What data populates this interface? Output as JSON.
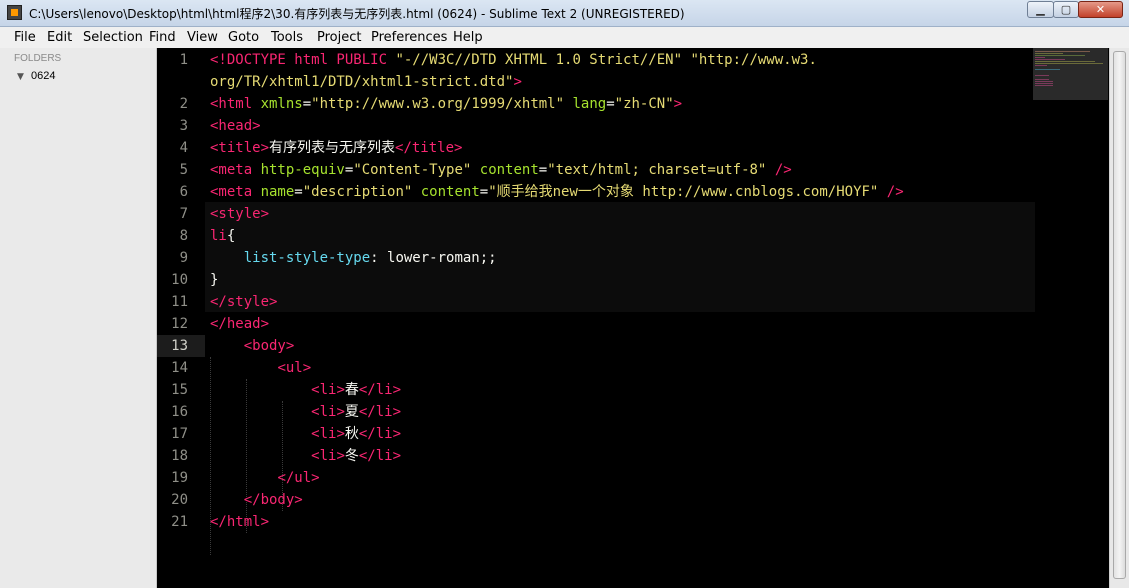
{
  "window": {
    "title": "C:\\Users\\lenovo\\Desktop\\html\\html程序2\\30.有序列表与无序列表.html (0624) - Sublime Text 2 (UNREGISTERED)",
    "minimize_glyph": "▁",
    "maximize_glyph": "▢",
    "close_glyph": "✕"
  },
  "menu": {
    "items": [
      "File",
      "Edit",
      "Selection",
      "Find",
      "View",
      "Goto",
      "Tools",
      "Project",
      "Preferences",
      "Help"
    ]
  },
  "sidebar": {
    "header": "FOLDERS",
    "arrow": "▼",
    "folder": "0624"
  },
  "editor": {
    "line_numbers": [
      "1",
      "2",
      "3",
      "4",
      "5",
      "6",
      "7",
      "8",
      "9",
      "10",
      "11",
      "12",
      "13",
      "14",
      "15",
      "16",
      "17",
      "18",
      "19",
      "20",
      "21"
    ],
    "current_line": "13",
    "lines": [
      [
        {
          "c": "tag",
          "t": "<!DOCTYPE html PUBLIC "
        },
        {
          "c": "str",
          "t": "\"-//W3C//DTD XHTML 1.0 Strict//EN\" \"http://www.w3."
        }
      ],
      [
        {
          "c": "str",
          "t": "org/TR/xhtml1/DTD/xhtml1-strict.dtd\""
        },
        {
          "c": "tag",
          "t": ">"
        }
      ],
      [
        {
          "c": "tag",
          "t": "<html "
        },
        {
          "c": "attr",
          "t": "xmlns"
        },
        {
          "c": "txt",
          "t": "="
        },
        {
          "c": "str",
          "t": "\"http://www.w3.org/1999/xhtml\""
        },
        {
          "c": "txt",
          "t": " "
        },
        {
          "c": "attr",
          "t": "lang"
        },
        {
          "c": "txt",
          "t": "="
        },
        {
          "c": "str",
          "t": "\"zh-CN\""
        },
        {
          "c": "tag",
          "t": ">"
        }
      ],
      [
        {
          "c": "tag",
          "t": "<head>"
        }
      ],
      [
        {
          "c": "tag",
          "t": "<title>"
        },
        {
          "c": "txt",
          "t": "有序列表与无序列表"
        },
        {
          "c": "tag",
          "t": "</title>"
        }
      ],
      [
        {
          "c": "tag",
          "t": "<meta "
        },
        {
          "c": "attr",
          "t": "http-equiv"
        },
        {
          "c": "txt",
          "t": "="
        },
        {
          "c": "str",
          "t": "\"Content-Type\""
        },
        {
          "c": "txt",
          "t": " "
        },
        {
          "c": "attr",
          "t": "content"
        },
        {
          "c": "txt",
          "t": "="
        },
        {
          "c": "str",
          "t": "\"text/html; charset=utf-8\""
        },
        {
          "c": "txt",
          "t": " "
        },
        {
          "c": "tag",
          "t": "/>"
        }
      ],
      [
        {
          "c": "tag",
          "t": "<meta "
        },
        {
          "c": "attr",
          "t": "name"
        },
        {
          "c": "txt",
          "t": "="
        },
        {
          "c": "str",
          "t": "\"description\""
        },
        {
          "c": "txt",
          "t": " "
        },
        {
          "c": "attr",
          "t": "content"
        },
        {
          "c": "txt",
          "t": "="
        },
        {
          "c": "str",
          "t": "\"顺手给我new一个对象 http://www.cnblogs.com/HOYF\""
        },
        {
          "c": "txt",
          "t": " "
        },
        {
          "c": "tag",
          "t": "/>"
        }
      ],
      [
        {
          "c": "tag",
          "t": "<style>"
        }
      ],
      [
        {
          "c": "tag",
          "t": "li"
        },
        {
          "c": "txt",
          "t": "{"
        }
      ],
      [
        {
          "c": "txt",
          "t": "    "
        },
        {
          "c": "prop",
          "t": "list-style-type"
        },
        {
          "c": "txt",
          "t": ": lower-roman;;"
        }
      ],
      [
        {
          "c": "txt",
          "t": "}"
        }
      ],
      [
        {
          "c": "tag",
          "t": "</style>"
        }
      ],
      [
        {
          "c": "tag",
          "t": "</head>"
        }
      ],
      [
        {
          "c": "txt",
          "t": "    "
        },
        {
          "c": "tag",
          "t": "<body>"
        }
      ],
      [
        {
          "c": "txt",
          "t": "        "
        },
        {
          "c": "tag",
          "t": "<ul>"
        }
      ],
      [
        {
          "c": "txt",
          "t": "            "
        },
        {
          "c": "tag",
          "t": "<li>"
        },
        {
          "c": "txt",
          "t": "春"
        },
        {
          "c": "tag",
          "t": "</li>"
        }
      ],
      [
        {
          "c": "txt",
          "t": "            "
        },
        {
          "c": "tag",
          "t": "<li>"
        },
        {
          "c": "txt",
          "t": "夏"
        },
        {
          "c": "tag",
          "t": "</li>"
        }
      ],
      [
        {
          "c": "txt",
          "t": "            "
        },
        {
          "c": "tag",
          "t": "<li>"
        },
        {
          "c": "txt",
          "t": "秋"
        },
        {
          "c": "tag",
          "t": "</li>"
        }
      ],
      [
        {
          "c": "txt",
          "t": "            "
        },
        {
          "c": "tag",
          "t": "<li>"
        },
        {
          "c": "txt",
          "t": "冬"
        },
        {
          "c": "tag",
          "t": "</li>"
        }
      ],
      [
        {
          "c": "txt",
          "t": "        "
        },
        {
          "c": "tag",
          "t": "</ul>"
        }
      ],
      [
        {
          "c": "txt",
          "t": "    "
        },
        {
          "c": "tag",
          "t": "</body>"
        }
      ],
      [
        {
          "c": "tag",
          "t": "</html>"
        }
      ]
    ]
  },
  "colors": {
    "background": "#000000",
    "tag": "#f92672",
    "attribute": "#a6e22e",
    "string": "#e6db74",
    "text": "#f8f8f2",
    "property": "#66d9ef",
    "line_number": "#8f8f88"
  }
}
